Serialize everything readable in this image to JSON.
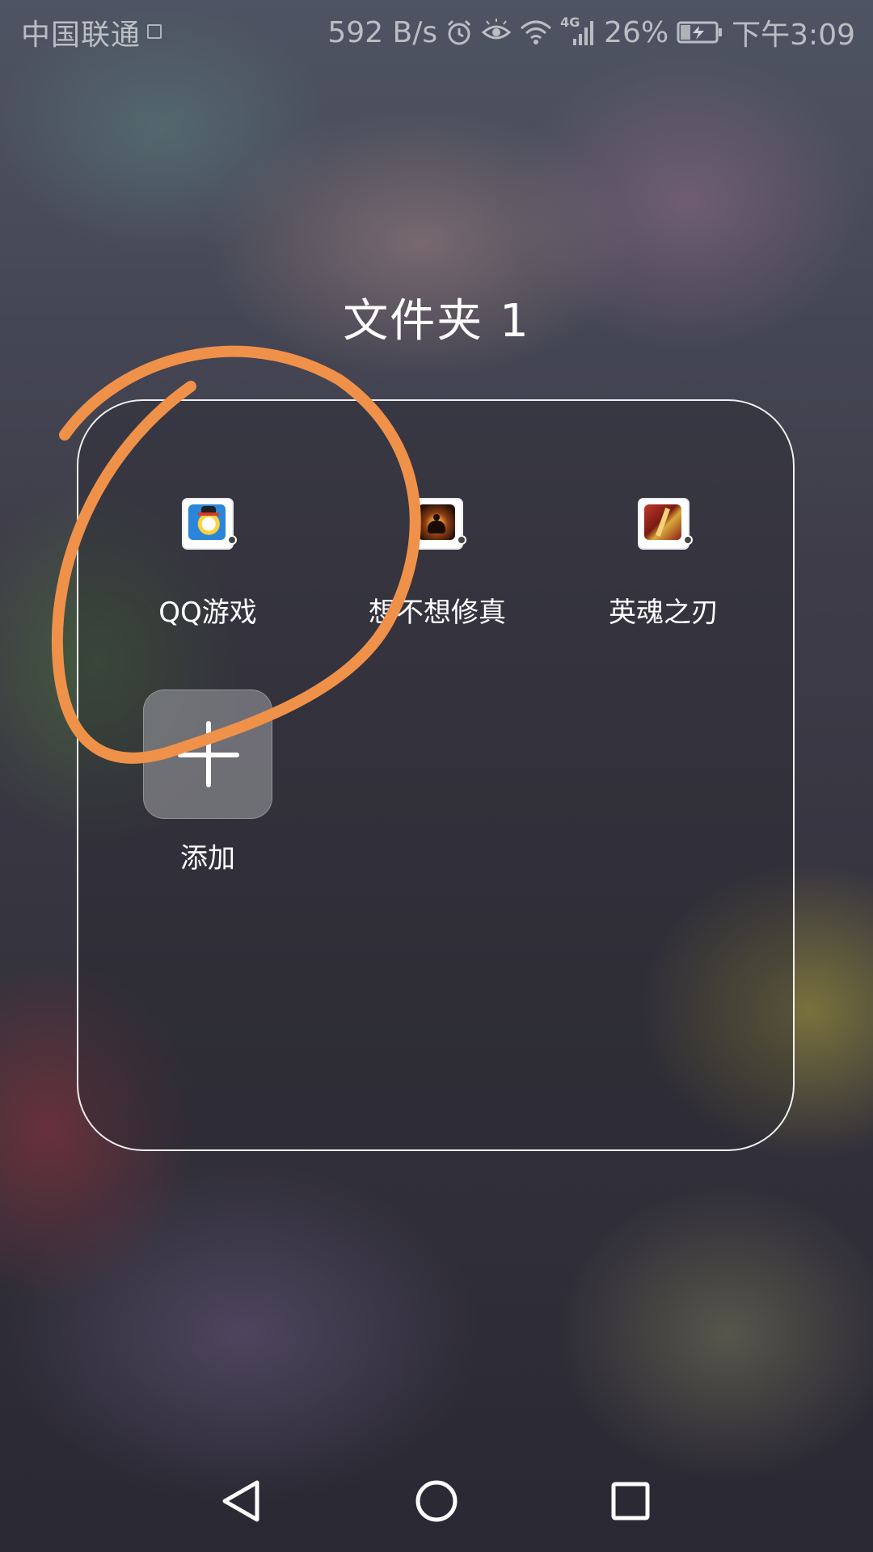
{
  "status_bar": {
    "carrier": "中国联通",
    "network_speed": "592 B/s",
    "network_type": "4G",
    "battery_percent": "26%",
    "time": "下午3:09",
    "icons": [
      "sim-icon",
      "alarm-icon",
      "eye-comfort-icon",
      "wifi-icon",
      "signal-icon",
      "battery-charging-icon"
    ]
  },
  "folder": {
    "title": "文件夹 1",
    "apps": [
      {
        "label": "QQ游戏",
        "icon": "qq-games-icon"
      },
      {
        "label": "想不想修真",
        "icon": "cultivation-game-icon"
      },
      {
        "label": "英魂之刃",
        "icon": "hero-blade-icon"
      }
    ],
    "add_label": "添加"
  },
  "nav_bar": {
    "buttons": [
      "back-icon",
      "home-icon",
      "recents-icon"
    ]
  },
  "colors": {
    "annotation_stroke": "#F0914A",
    "folder_border": "#FFFFFF",
    "text": "#FFFFFF"
  }
}
